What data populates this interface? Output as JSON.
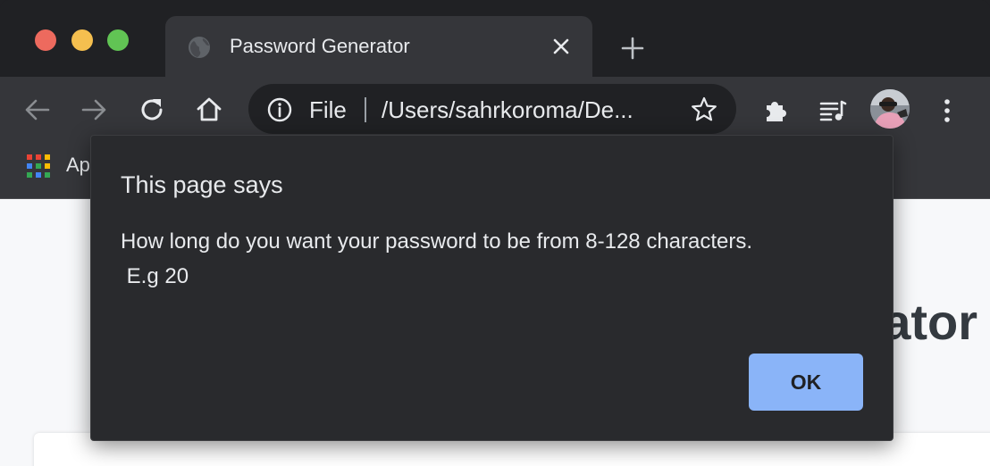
{
  "window": {
    "traffic_lights": [
      "close",
      "minimize",
      "maximize"
    ]
  },
  "tab": {
    "title": "Password Generator",
    "icon": "globe-icon"
  },
  "toolbar": {
    "back_icon": "back-arrow-icon",
    "forward_icon": "forward-arrow-icon",
    "reload_icon": "reload-icon",
    "home_icon": "home-icon",
    "omnibox": {
      "scheme_label": "File",
      "url": "/Users/sahrkoroma/De..."
    }
  },
  "bookmarks": {
    "apps_label": "Apps"
  },
  "page": {
    "heading_fragment": "ator"
  },
  "dialog": {
    "title": "This page says",
    "message": "How long do you want your password to be from 8-128 characters.\n E.g 20",
    "ok_label": "OK"
  },
  "colors": {
    "accent": "#8ab4f8",
    "tabbar_bg": "#202124",
    "toolbar_bg": "#35363a",
    "dialog_bg": "#292a2d",
    "page_bg": "#f7f8fa"
  }
}
